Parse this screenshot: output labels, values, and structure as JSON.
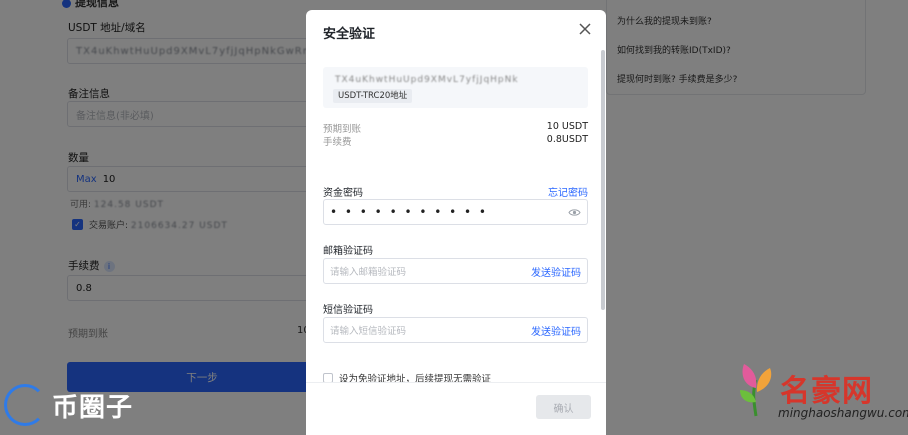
{
  "background": {
    "section_title": "提现信息",
    "address_label": "USDT 地址/域名",
    "address_value": "TX4uKhwtHuUpd9XMvL7yfjJqHpNkGwRmt8",
    "remark_label": "备注信息",
    "remark_placeholder": "备注信息(非必填)",
    "amount_label": "数量",
    "amount_max": "Max",
    "amount_value": "10",
    "available_label": "可用:",
    "available_value": "124.58 USDT",
    "trade_account_label": "交易账户:",
    "trade_account_value": "2106634.27 USDT",
    "fee_label": "手续费",
    "fee_value": "0.8",
    "eta_label": "预期到账",
    "eta_value": "10",
    "next_button": "下一步",
    "faq": [
      "为什么我的提现未到账?",
      "如何找到我的转账ID(TxID)?",
      "提现何时到账? 手续费是多少?"
    ]
  },
  "watermarks": {
    "left_text": "币圈子",
    "right_title": "名豪网",
    "right_sub": "minghaoshangwu.com"
  },
  "modal": {
    "title": "安全验证",
    "address_masked": "TX4uKhwtHuUpd9XMvL7yfjJqHpNk",
    "address_tag": "USDT-TRC20地址",
    "eta_label": "预期到账",
    "eta_value": "10 USDT",
    "fee_label": "手续费",
    "fee_value": "0.8USDT",
    "fund_password_label": "资金密码",
    "forgot_password": "忘记密码",
    "fund_password_value": "• • • • • • • • • • •",
    "email_code_label": "邮箱验证码",
    "email_code_placeholder": "请输入邮箱验证码",
    "send_code": "发送验证码",
    "sms_code_label": "短信验证码",
    "sms_code_placeholder": "请输入短信验证码",
    "whitelist_text": "设为免验证地址，后续提现无需验证",
    "confirm_button": "确认"
  },
  "colors": {
    "accent": "#2a67ff",
    "overlay": "rgba(0,0,0,0.5)",
    "watermark_red": "#d6362b"
  }
}
